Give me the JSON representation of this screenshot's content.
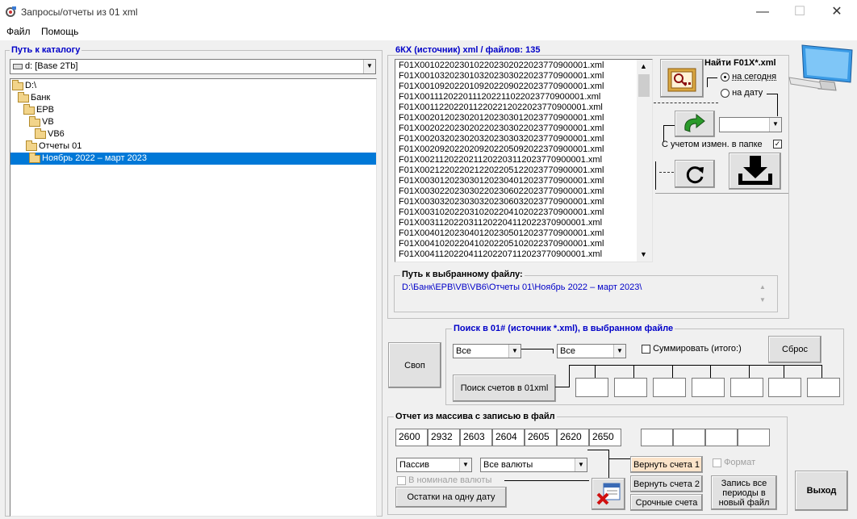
{
  "window": {
    "title": "Запросы/отчеты из 01 xml"
  },
  "menu": {
    "file": "Файл",
    "help": "Помощь"
  },
  "left": {
    "group_title": "Путь к каталогу",
    "drive": "d: [Base 2Tb]",
    "tree": [
      "D:\\",
      "Банк",
      "EPB",
      "VB",
      "VB6",
      "Отчеты 01",
      "Ноябрь 2022 – март 2023"
    ]
  },
  "files": {
    "group_title": "6КХ (источник) xml / файлов: 135",
    "items": [
      "F01X0010220230102202302022023770900001.xml",
      "F01X0010320230103202303022023770900001.xml",
      "F01X0010920220109202209022023770900001.xml",
      "F01X0011120220111202211022023770900001.xml",
      "F01X0011220220112202212022023770900001.xml",
      "F01X0020120230201202303012023770900001.xml",
      "F01X0020220230202202303022023770900001.xml",
      "F01X0020320230203202303032023770900001.xml",
      "F01X0020920220209202205092022370900001.xml",
      "F01X0021120220211202203112023770900001.xml",
      "F01X0021220220212202205122023770900001.xml",
      "F01X0030120230301202304012023770900001.xml",
      "F01X0030220230302202306022023770900001.xml",
      "F01X0030320230303202306032023770900001.xml",
      "F01X0031020220310202204102022370900001.xml",
      "F01X0031120220311202204112022370900001.xml",
      "F01X0040120230401202305012023770900001.xml",
      "F01X0041020220410202205102022370900001.xml",
      "F01X0041120220411202207112023770900001.xml"
    ]
  },
  "find": {
    "label": "Найти F01X*.xml",
    "today": "на сегодня",
    "date": "на дату",
    "changes": "С учетом измен. в папке",
    "changes_checked": "✓"
  },
  "path": {
    "title": "Путь к выбранному файлу:",
    "value": "D:\\Банк\\EPB\\VB\\VB6\\Отчеты 01\\Ноябрь 2022 – март 2023\\"
  },
  "search": {
    "title": "Поиск в 01# (источник *.xml), в выбранном файле",
    "combo1": "Все",
    "combo2": "Все",
    "sum_label": "Суммировать (итого:)",
    "reset": "Сброс",
    "find_accounts": "Поиск счетов в 01xml"
  },
  "svop": "Своп",
  "report": {
    "title": "Отчет из массива с записью в файл",
    "codes": [
      "2600",
      "2932",
      "2603",
      "2604",
      "2605",
      "2620",
      "2650"
    ],
    "passive": "Пассив",
    "currencies": "Все валюты",
    "nominal": "В номинале валюты",
    "balance_one_date": "Остатки на одну дату",
    "return1": "Вернуть счета 1",
    "return2": "Вернуть счета 2",
    "urgent": "Срочные счета",
    "format": "Формат",
    "record_all": "Запись все периоды в новый файл"
  },
  "exit": "Выход"
}
